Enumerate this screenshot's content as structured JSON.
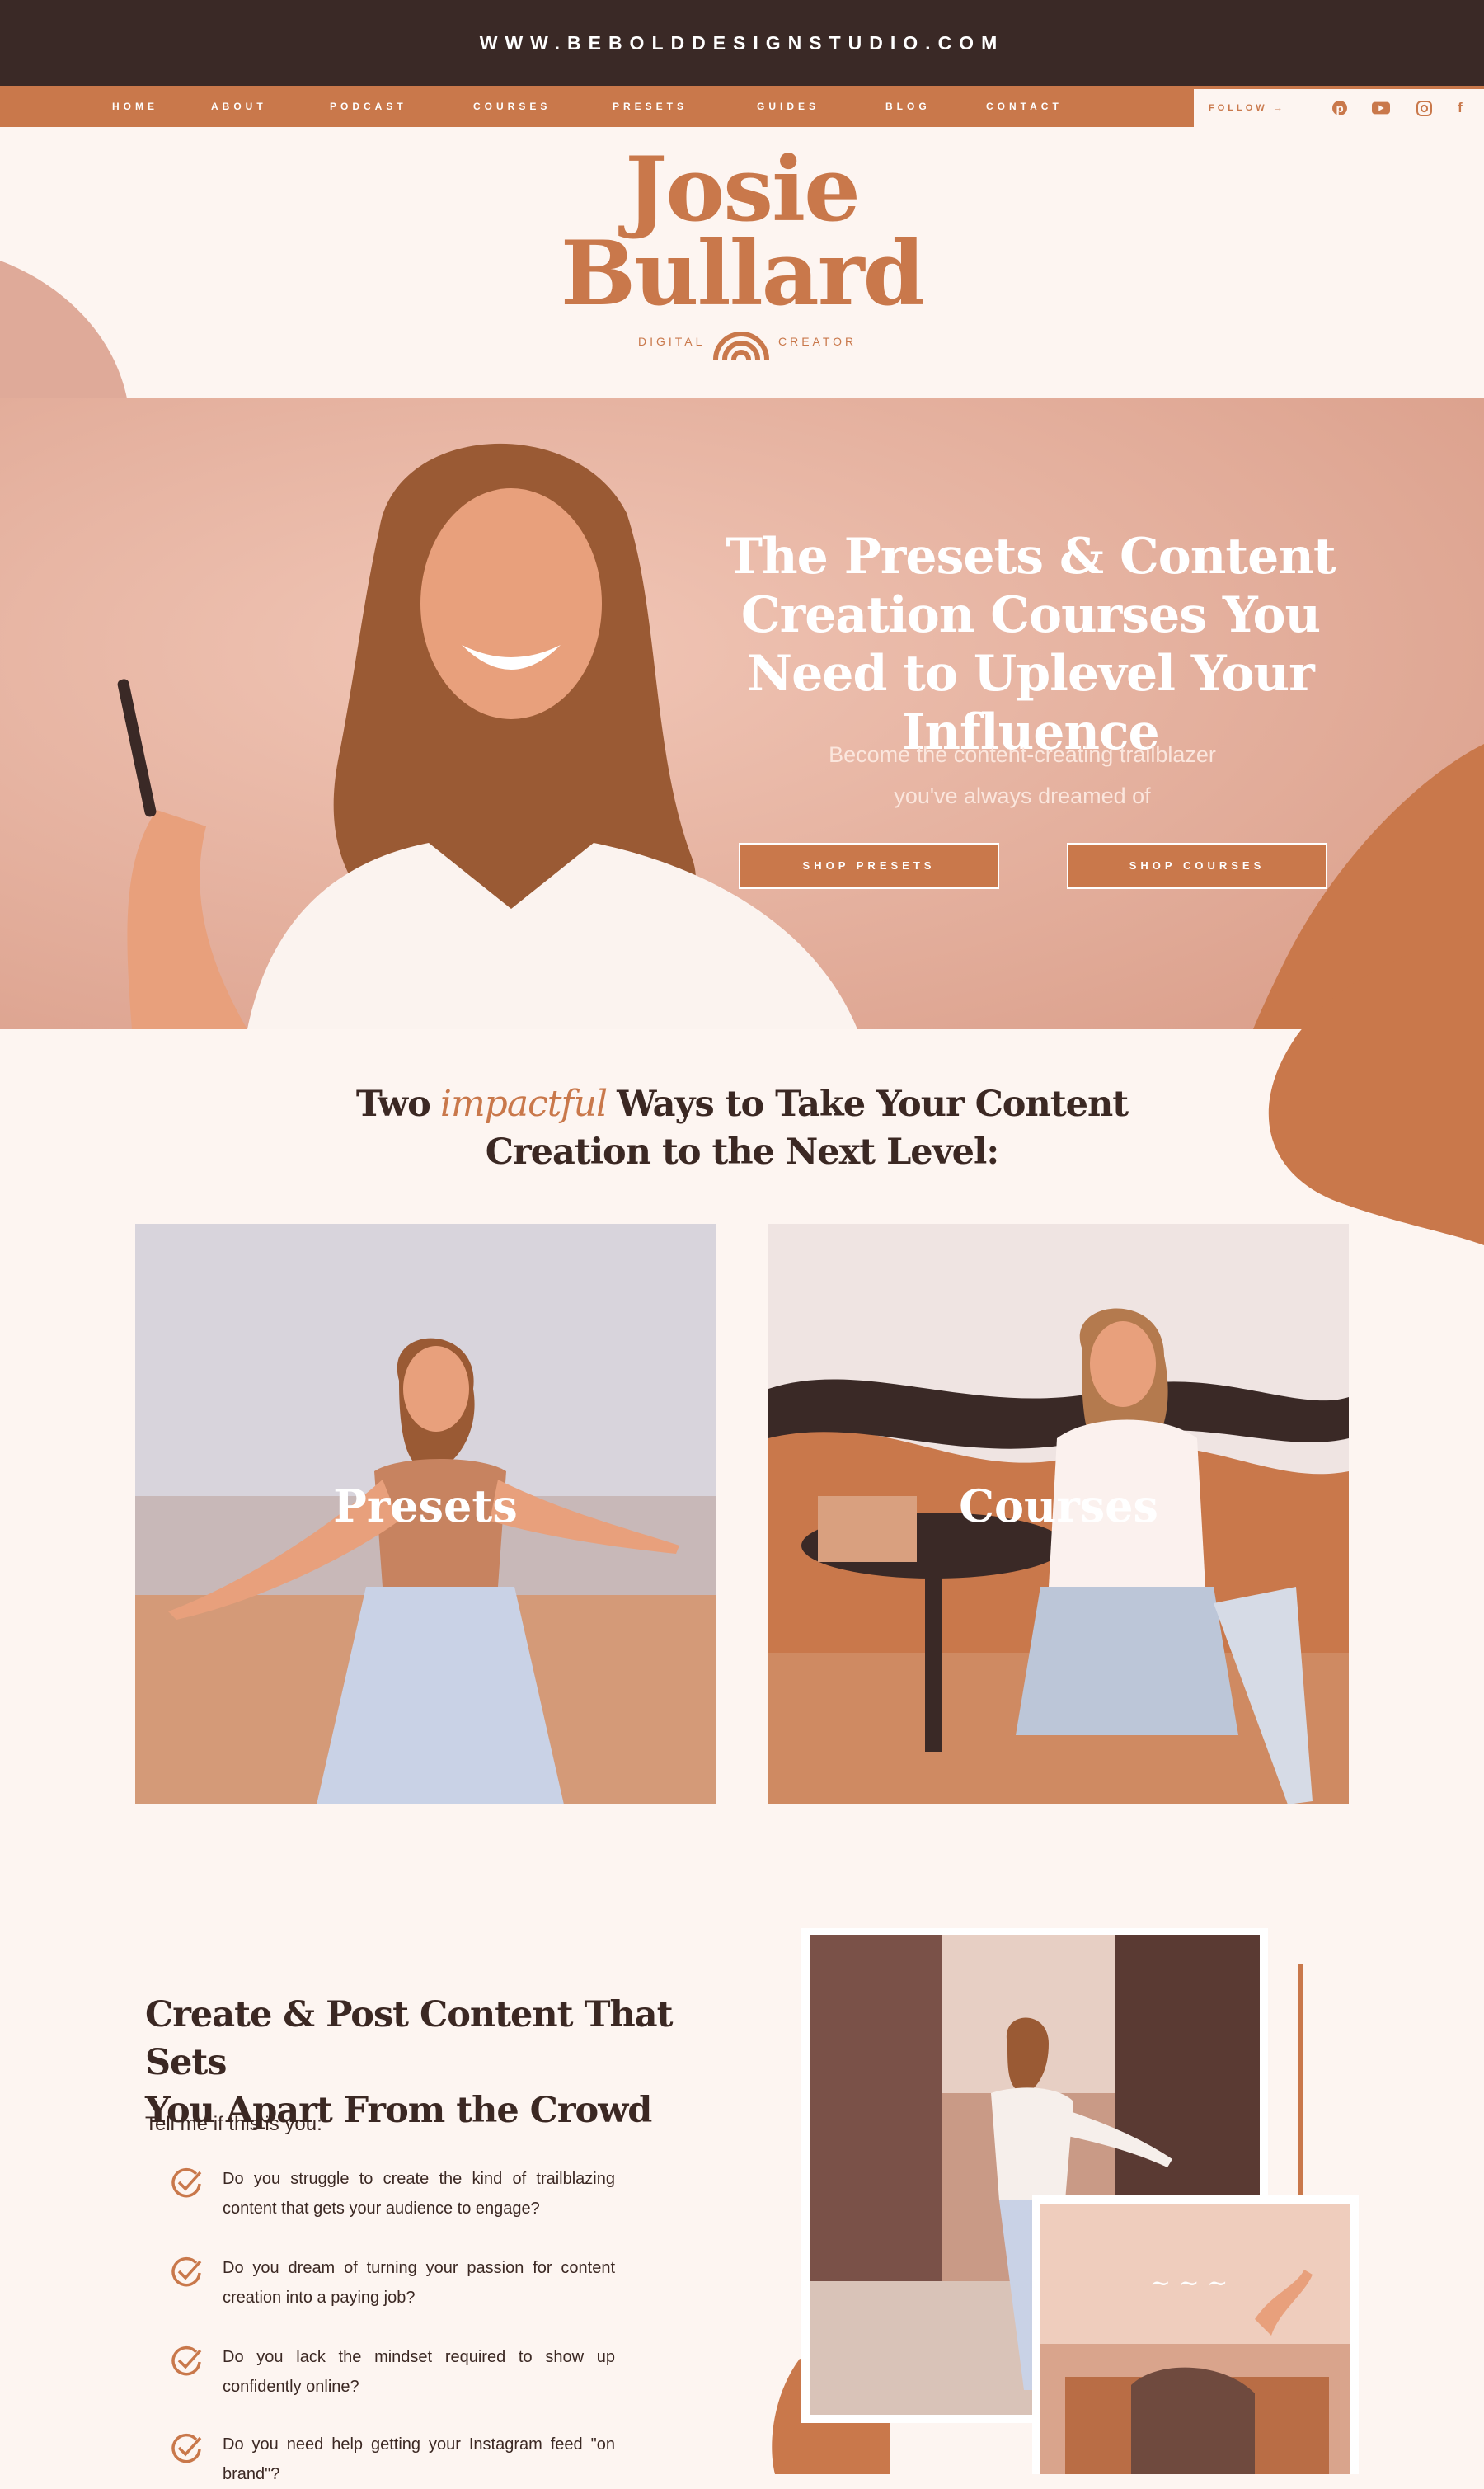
{
  "topbar": {
    "url": "WWW.BEBOLDDESIGNSTUDIO.COM"
  },
  "nav": {
    "items": [
      "HOME",
      "ABOUT",
      "PODCAST",
      "COURSES",
      "PRESETS",
      "GUIDES",
      "BLOG",
      "CONTACT"
    ],
    "follow_label": "FOLLOW →",
    "social": [
      "pinterest-icon",
      "youtube-icon",
      "instagram-icon",
      "facebook-icon"
    ]
  },
  "logo": {
    "first": "Josie",
    "last": "Bullard",
    "left_word": "DIGITAL",
    "right_word": "CREATOR"
  },
  "hero": {
    "title": "The Presets & Content Creation Courses You Need to Uplevel Your Influence",
    "subtitle_line1": "Become the content-creating trailblazer",
    "subtitle_line2": "you've always dreamed of",
    "btn_presets": "SHOP PRESETS",
    "btn_courses": "SHOP COURSES"
  },
  "ways": {
    "title_part1": "Two",
    "title_script": "impactful",
    "title_part2": "Ways to Take Your Content",
    "title_line2": "Creation to the Next Level:",
    "cards": [
      "Presets",
      "Courses"
    ]
  },
  "lower": {
    "title_line1": "Create & Post Content That Sets",
    "title_line2": "You Apart From the Crowd",
    "lead": "Tell me if this is you:",
    "items": [
      "Do you struggle to create the kind of trailblazing content that gets your audience to engage?",
      "Do you dream of turning your passion for content creation into a paying job?",
      "Do you lack the mindset required to show up confidently online?",
      "Do you need help getting your Instagram feed \"on brand\"?"
    ]
  },
  "colors": {
    "dark": "#3a2926",
    "accent": "#c9784b",
    "blush": "#e8b4a3",
    "cream": "#fdf5f1"
  }
}
